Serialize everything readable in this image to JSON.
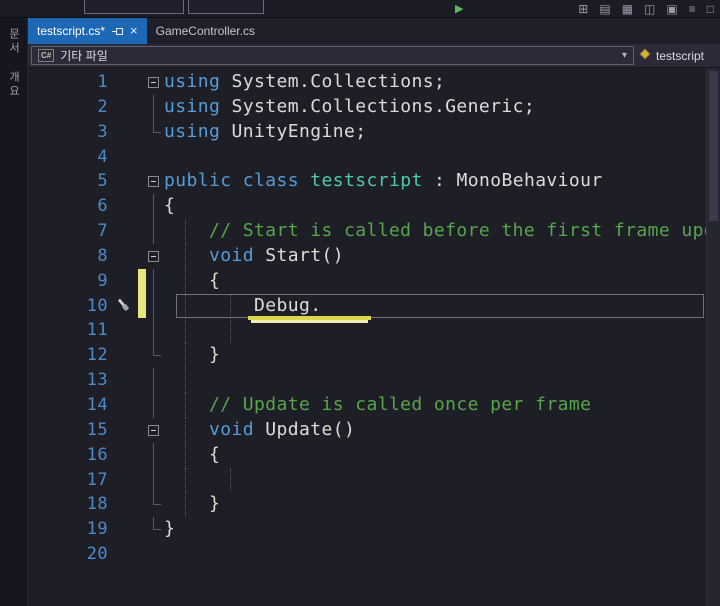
{
  "colors": {
    "active_tab": "#1d68b5",
    "keyword": "#569cd6",
    "type": "#4ec9b0",
    "comment": "#57a64a",
    "text": "#dcdcdc",
    "line_number": "#4e8ac8",
    "change_bar": "#e8e87a",
    "underline": "#dcd94e",
    "run": "#5bbf5b"
  },
  "toolbar": {
    "play_glyph": "▶",
    "icons": [
      {
        "name": "find-in-files-icon",
        "glyph": "⊞"
      },
      {
        "name": "bookmarks-icon",
        "glyph": "▤"
      },
      {
        "name": "toolbox-icon",
        "glyph": "▦"
      },
      {
        "name": "split-window-icon",
        "glyph": "◫"
      },
      {
        "name": "solution-explorer-icon",
        "glyph": "▣"
      },
      {
        "name": "menu-icon",
        "glyph": "≡"
      },
      {
        "name": "properties-icon",
        "glyph": "□"
      }
    ]
  },
  "sidebar": {
    "tabs": [
      "문서 개요"
    ]
  },
  "tabs": [
    {
      "label": "testscript.cs*",
      "active": true,
      "close_glyph": "×"
    },
    {
      "label": "GameController.cs",
      "active": false
    }
  ],
  "navbar": {
    "file_icon": "C#",
    "left_value": "기타 파일",
    "arrow_glyph": "▾",
    "right_value": "testscript"
  },
  "editor": {
    "lines": [
      {
        "n": "1",
        "fold": "box",
        "segs": [
          [
            "kw",
            "using"
          ],
          [
            "pl",
            " System.Collections;"
          ]
        ]
      },
      {
        "n": "2",
        "fold": "bar",
        "segs": [
          [
            "kw",
            "using"
          ],
          [
            "pl",
            " System.Collections.Generic;"
          ]
        ]
      },
      {
        "n": "3",
        "fold": "end",
        "segs": [
          [
            "kw",
            "using"
          ],
          [
            "pl",
            " UnityEngine;"
          ]
        ]
      },
      {
        "n": "4",
        "fold": "",
        "segs": []
      },
      {
        "n": "5",
        "fold": "box",
        "segs": [
          [
            "kw",
            "public"
          ],
          [
            "pl",
            " "
          ],
          [
            "kw",
            "class"
          ],
          [
            "pl",
            " "
          ],
          [
            "ty",
            "testscript"
          ],
          [
            "pl",
            " : MonoBehaviour"
          ]
        ]
      },
      {
        "n": "6",
        "fold": "bar",
        "segs": [
          [
            "pl",
            "{"
          ]
        ]
      },
      {
        "n": "7",
        "fold": "bar",
        "guides": [
          0
        ],
        "segs": [
          [
            "cm",
            "    // Start is called before the first frame update"
          ]
        ]
      },
      {
        "n": "8",
        "fold": "box",
        "guides": [
          0
        ],
        "segs": [
          [
            "pl",
            "    "
          ],
          [
            "kw",
            "void"
          ],
          [
            "pl",
            " Start()"
          ]
        ]
      },
      {
        "n": "9",
        "fold": "bar",
        "guides": [
          0
        ],
        "changed": true,
        "segs": [
          [
            "pl",
            "    {"
          ]
        ]
      },
      {
        "n": "10",
        "fold": "bar",
        "guides": [
          0,
          4
        ],
        "changed": true,
        "current": true,
        "glyph": "screwdriver-quick-action-icon",
        "underline": {
          "startCol": 6,
          "cols": 11
        },
        "segs": [
          [
            "pl",
            "        Debug."
          ]
        ]
      },
      {
        "n": "11",
        "fold": "bar",
        "guides": [
          0,
          4
        ],
        "segs": []
      },
      {
        "n": "12",
        "fold": "end",
        "guides": [
          0
        ],
        "segs": [
          [
            "pl",
            "    }"
          ]
        ]
      },
      {
        "n": "13",
        "fold": "bar",
        "guides": [
          0
        ],
        "segs": []
      },
      {
        "n": "14",
        "fold": "bar",
        "guides": [
          0
        ],
        "segs": [
          [
            "cm",
            "    // Update is called once per frame"
          ]
        ]
      },
      {
        "n": "15",
        "fold": "box",
        "guides": [
          0
        ],
        "segs": [
          [
            "pl",
            "    "
          ],
          [
            "kw",
            "void"
          ],
          [
            "pl",
            " Update()"
          ]
        ]
      },
      {
        "n": "16",
        "fold": "bar",
        "guides": [
          0
        ],
        "segs": [
          [
            "pl",
            "    {"
          ]
        ]
      },
      {
        "n": "17",
        "fold": "bar",
        "guides": [
          0,
          4
        ],
        "segs": []
      },
      {
        "n": "18",
        "fold": "end",
        "guides": [
          0
        ],
        "segs": [
          [
            "pl",
            "    }"
          ]
        ]
      },
      {
        "n": "19",
        "fold": "end",
        "segs": [
          [
            "pl",
            "}"
          ]
        ]
      },
      {
        "n": "20",
        "fold": "",
        "segs": []
      }
    ]
  }
}
